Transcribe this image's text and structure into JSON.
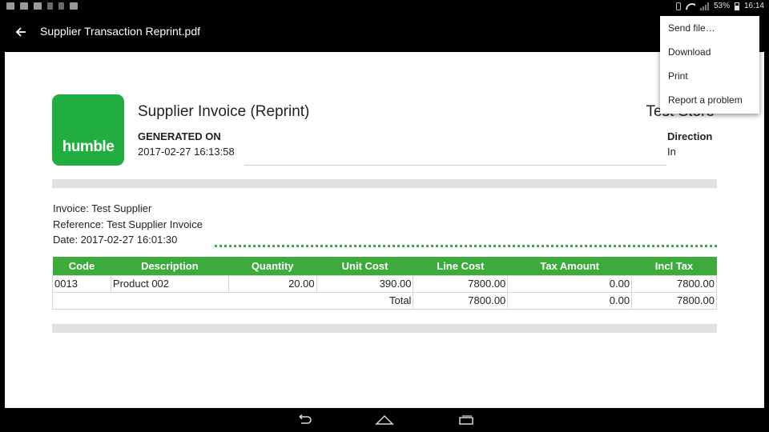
{
  "status_bar": {
    "battery": "53%",
    "time": "16:14"
  },
  "app_bar": {
    "title": "Supplier Transaction Reprint.pdf"
  },
  "menu": {
    "items": [
      {
        "label": "Send file…"
      },
      {
        "label": "Download"
      },
      {
        "label": "Print"
      },
      {
        "label": "Report a problem"
      }
    ]
  },
  "document": {
    "logo_text": "humble",
    "title": "Supplier Invoice (Reprint)",
    "store": "Test Store",
    "generated_label": "GENERATED ON",
    "generated_value": "2017-02-27 16:13:58",
    "direction_label": "Direction",
    "direction_value": "In",
    "invoice": "Invoice: Test Supplier",
    "reference": "Reference: Test Supplier Invoice",
    "date": "Date: 2017-02-27 16:01:30",
    "table": {
      "headers": [
        "Code",
        "Description",
        "Quantity",
        "Unit Cost",
        "Line Cost",
        "Tax Amount",
        "Incl Tax"
      ],
      "rows": [
        [
          "0013",
          "Product 002",
          "20.00",
          "390.00",
          "7800.00",
          "0.00",
          "7800.00"
        ]
      ],
      "total": {
        "label": "Total",
        "line_cost": "7800.00",
        "tax_amount": "0.00",
        "incl_tax": "7800.00"
      }
    }
  },
  "colors": {
    "brand_green": "#1fae3f",
    "table_header": "#3cab3c"
  }
}
